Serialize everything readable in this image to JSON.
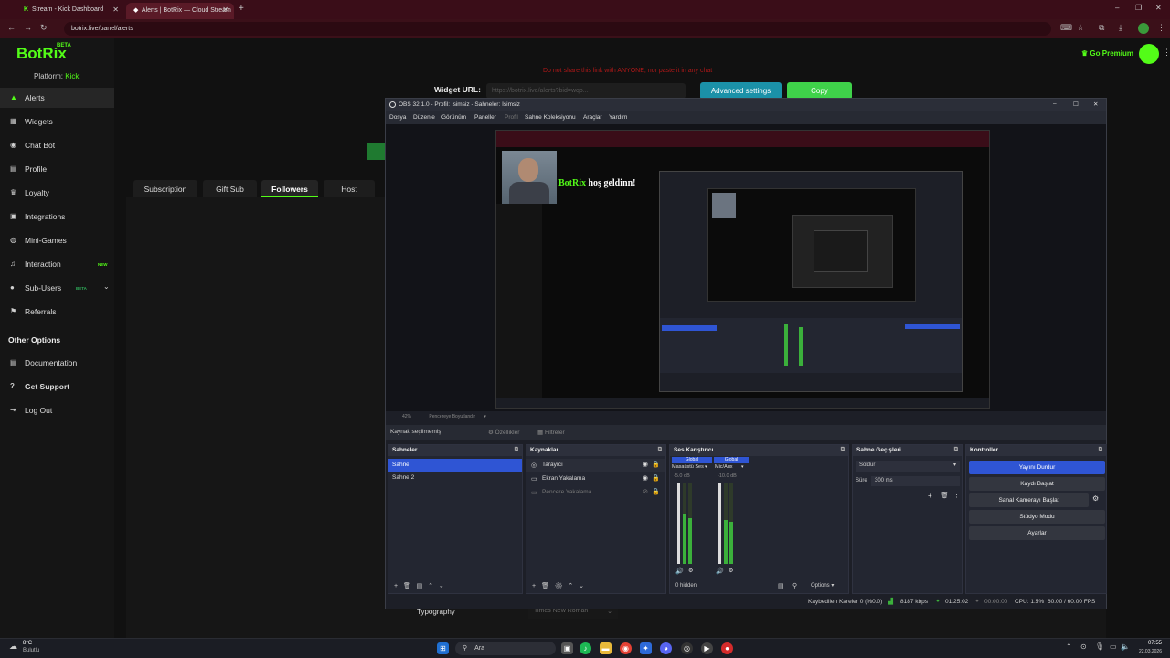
{
  "browser": {
    "tabs": [
      {
        "title": "Stream - Kick Dashboard",
        "icon": "kick-icon",
        "active": false
      },
      {
        "title": "Alerts | BotRix — Cloud Stream",
        "icon": "botrix-icon",
        "active": true
      }
    ],
    "new_tab": "+",
    "url": "botrix.live/panel/alerts"
  },
  "botrix": {
    "brand": "BotRix",
    "beta": "BETA",
    "platform_label": "Platform:",
    "platform_value": "Kick",
    "go_premium": "Go Premium",
    "nav": [
      {
        "label": "Alerts",
        "icon": "alert-icon"
      },
      {
        "label": "Widgets",
        "icon": "grid-icon"
      },
      {
        "label": "Chat Bot",
        "icon": "bot-icon"
      },
      {
        "label": "Profile",
        "icon": "profile-icon"
      },
      {
        "label": "Loyalty",
        "icon": "trophy-icon"
      },
      {
        "label": "Integrations",
        "icon": "integrations-icon"
      },
      {
        "label": "Mini-Games",
        "icon": "gamepad-icon"
      },
      {
        "label": "Interaction",
        "icon": "music-icon",
        "badge": "NEW"
      },
      {
        "label": "Sub-Users",
        "icon": "users-icon",
        "badge": "BETA"
      },
      {
        "label": "Referrals",
        "icon": "referrals-icon"
      }
    ],
    "other_options_title": "Other Options",
    "other_nav": [
      {
        "label": "Documentation",
        "icon": "docs-icon"
      },
      {
        "label": "Get Support",
        "icon": "support-icon"
      },
      {
        "label": "Log Out",
        "icon": "logout-icon"
      }
    ],
    "warning": "Do not share this link with ANYONE, nor paste it in any chat",
    "widget_url_label": "Widget URL:",
    "widget_url_value": "https://botrix.live/alerts?bid=wqo...",
    "advanced_settings": "Advanced settings",
    "copy": "Copy",
    "tabs": [
      "Subscription",
      "Gift Sub",
      "Followers",
      "Host"
    ],
    "active_tab": "Followers",
    "typography_label": "Typography",
    "typography_value": "Times New Roman"
  },
  "obs": {
    "title": "OBS 32.1.0 - Profil: İsimsiz - Sahneler: İsimsiz",
    "menu": [
      "Dosya",
      "Düzenle",
      "Görünüm",
      "Paneller",
      "Profil",
      "Sahne Koleksiyonu",
      "Araçlar",
      "Yardım"
    ],
    "preview_greeting": "BotRix",
    "preview_greeting_rest": "hoş geldinn!",
    "zoom_text": "42%",
    "zoom_mode": "Pencereye Boyutlandır",
    "no_source": "Kaynak seçilmemiş",
    "properties": "Özellikler",
    "filters": "Filtreler",
    "scenes_title": "Sahneler",
    "scenes": [
      "Sahne",
      "Sahne 2"
    ],
    "sources_title": "Kaynaklar",
    "sources": [
      {
        "name": "Tarayıcı",
        "icon": "globe-icon"
      },
      {
        "name": "Ekran Yakalama",
        "icon": "monitor-icon"
      },
      {
        "name": "Pencere Yakalama",
        "icon": "window-icon"
      }
    ],
    "mixer_title": "Ses Karıştırıcı",
    "mixer_global": "Global",
    "mixer_channels": [
      {
        "name": "Masaüstü Ses",
        "db": "-5.0 dB",
        "level": 0.62
      },
      {
        "name": "Mic/Aux",
        "db": "-10.0 dB",
        "level": 0.55
      }
    ],
    "mixer_hidden": "0 hidden",
    "mixer_options": "Options",
    "transitions_title": "Sahne Geçişleri",
    "transition_value": "Soldur",
    "duration_label": "Süre",
    "duration_value": "300 ms",
    "controls_title": "Kontroller",
    "controls": [
      "Yayını Durdur",
      "Kaydı Başlat",
      "Sanal Kamerayı Başlat",
      "Stüdyo Modu",
      "Ayarlar"
    ],
    "status": {
      "dropped": "Kaybedilen Kareler 0 (%0.0)",
      "bitrate": "8187 kbps",
      "stream_time": "01:25:02",
      "rec_time": "00:00:00",
      "cpu": "CPU: 1.5%",
      "fps": "60.00 / 60.00 FPS"
    }
  },
  "taskbar": {
    "weather_temp": "8°C",
    "weather_text": "Bulutlu",
    "search": "Ara",
    "time": "07:55",
    "date": "22.03.2026"
  }
}
